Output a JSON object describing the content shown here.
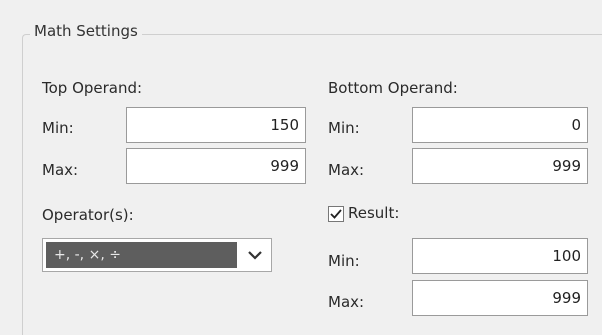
{
  "group": {
    "title": "Math Settings"
  },
  "top_operand": {
    "heading": "Top Operand:",
    "min_label": "Min:",
    "min_value": "150",
    "max_label": "Max:",
    "max_value": "999"
  },
  "bottom_operand": {
    "heading": "Bottom Operand:",
    "min_label": "Min:",
    "min_value": "0",
    "max_label": "Max:",
    "max_value": "999"
  },
  "operators": {
    "label": "Operator(s):",
    "selected": "+, -, ×, ÷"
  },
  "result": {
    "label": "Result:",
    "checked": true,
    "min_label": "Min:",
    "min_value": "100",
    "max_label": "Max:",
    "max_value": "999"
  }
}
